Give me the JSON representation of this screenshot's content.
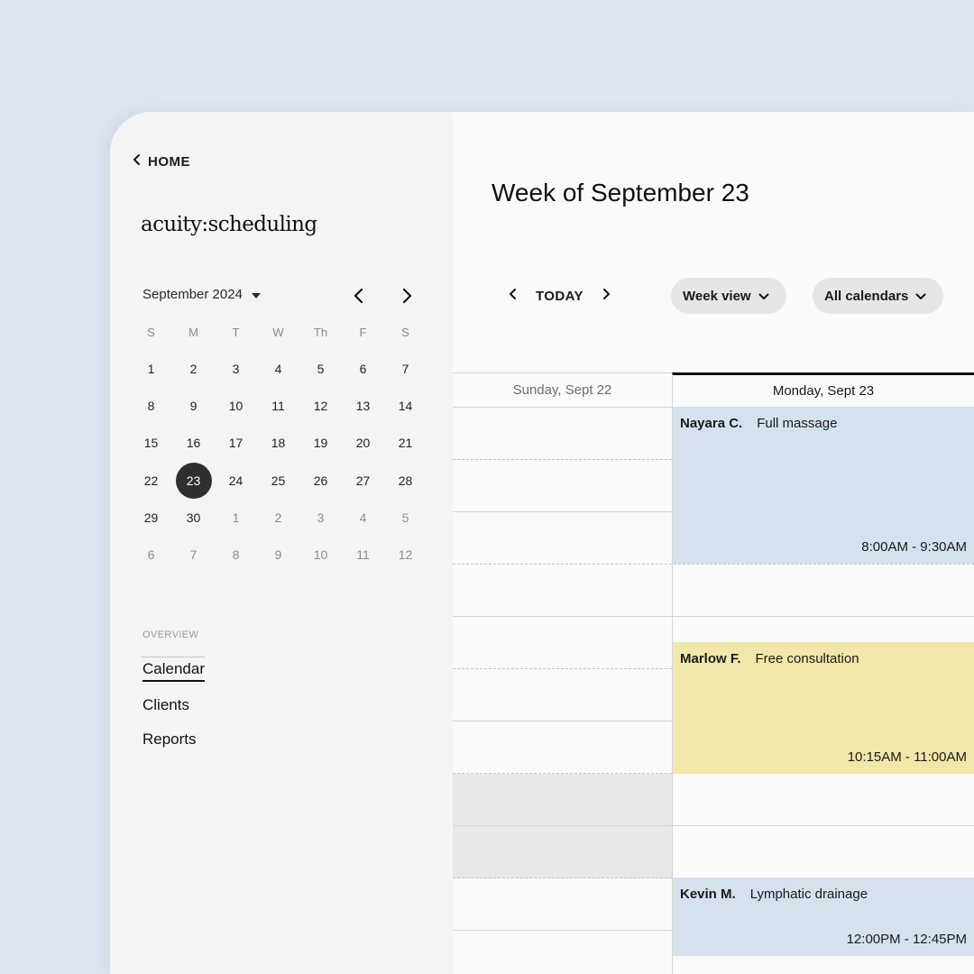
{
  "sidebar": {
    "home_label": "HOME",
    "logo": "acuity:scheduling",
    "mini_calendar": {
      "month_label": "September 2024",
      "weekdays": [
        "S",
        "M",
        "T",
        "W",
        "Th",
        "F",
        "S"
      ],
      "weeks": [
        [
          "1",
          "2",
          "3",
          "4",
          "5",
          "6",
          "7"
        ],
        [
          "8",
          "9",
          "10",
          "11",
          "12",
          "13",
          "14"
        ],
        [
          "15",
          "16",
          "17",
          "18",
          "19",
          "20",
          "21"
        ],
        [
          "22",
          "23",
          "24",
          "25",
          "26",
          "27",
          "28"
        ],
        [
          "29",
          "30",
          "1",
          "2",
          "3",
          "4",
          "5"
        ],
        [
          "6",
          "7",
          "8",
          "9",
          "10",
          "11",
          "12"
        ]
      ],
      "selected_day": "23"
    },
    "nav": {
      "section_label": "OVERVIEW",
      "items": [
        "Calendar",
        "Clients",
        "Reports"
      ],
      "active": "Calendar"
    }
  },
  "main": {
    "title": "Week of September 23",
    "toolbar": {
      "today_label": "TODAY",
      "view_label": "Week view",
      "calendars_label": "All calendars"
    },
    "columns": [
      "Sunday, Sept 22",
      "Monday, Sept 23"
    ],
    "events": [
      {
        "client": "Nayara C.",
        "service": "Full massage",
        "time": "8:00AM - 9:30AM",
        "color": "#d6e1ee"
      },
      {
        "client": "Marlow F.",
        "service": "Free consultation",
        "time": "10:15AM - 11:00AM",
        "color": "#f0e8a8"
      },
      {
        "client": "Kevin M.",
        "service": "Lymphatic drainage",
        "time": "12:00PM - 12:45PM",
        "color": "#d6e1ee"
      }
    ]
  },
  "colors": {
    "background": "#dee5ef",
    "selected_day": "#2f2f2f",
    "event_blue": "#d6e1ee",
    "event_yellow": "#f0e8a8"
  }
}
